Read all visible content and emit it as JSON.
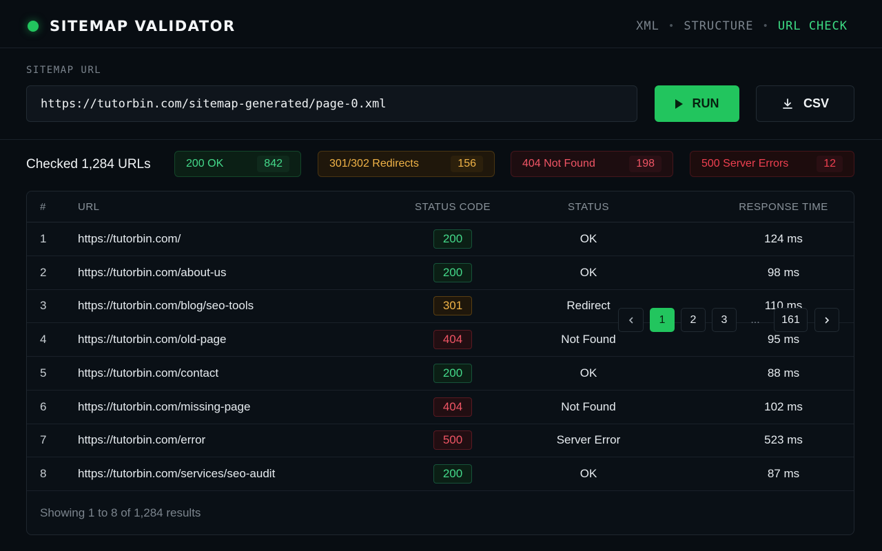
{
  "header": {
    "title": "SITEMAP VALIDATOR",
    "nav": [
      {
        "label": "XML",
        "active": false
      },
      {
        "label": "STRUCTURE",
        "active": false
      },
      {
        "label": "URL CHECK",
        "active": true
      }
    ]
  },
  "url_section": {
    "label": "SITEMAP URL",
    "value": "https://tutorbin.com/sitemap-generated/page-0.xml",
    "run_label": "RUN",
    "csv_label": "CSV"
  },
  "summary": {
    "checked_text": "Checked 1,284 URLs",
    "ok": {
      "label": "200 OK",
      "count": "842"
    },
    "redirects": {
      "label": "301/302 Redirects",
      "count": "156"
    },
    "not_found": {
      "label": "404 Not Found",
      "count": "198"
    },
    "server_errors": {
      "label": "500 Server Errors",
      "count": "12"
    }
  },
  "table": {
    "headers": {
      "num": "#",
      "url": "URL",
      "code": "STATUS CODE",
      "status": "STATUS",
      "time": "RESPONSE TIME"
    },
    "rows": [
      {
        "num": "1",
        "url": "https://tutorbin.com/",
        "code": "200",
        "status": "OK",
        "time": "124 ms"
      },
      {
        "num": "2",
        "url": "https://tutorbin.com/about-us",
        "code": "200",
        "status": "OK",
        "time": "98 ms"
      },
      {
        "num": "3",
        "url": "https://tutorbin.com/blog/seo-tools",
        "code": "301",
        "status": "Redirect",
        "time": "110 ms"
      },
      {
        "num": "4",
        "url": "https://tutorbin.com/old-page",
        "code": "404",
        "status": "Not Found",
        "time": "95 ms"
      },
      {
        "num": "5",
        "url": "https://tutorbin.com/contact",
        "code": "200",
        "status": "OK",
        "time": "88 ms"
      },
      {
        "num": "6",
        "url": "https://tutorbin.com/missing-page",
        "code": "404",
        "status": "Not Found",
        "time": "102 ms"
      },
      {
        "num": "7",
        "url": "https://tutorbin.com/error",
        "code": "500",
        "status": "Server Error",
        "time": "523 ms"
      },
      {
        "num": "8",
        "url": "https://tutorbin.com/services/seo-audit",
        "code": "200",
        "status": "OK",
        "time": "87 ms"
      }
    ],
    "footer_text": "Showing 1 to 8 of 1,284 results"
  },
  "pagination": {
    "prev_icon": "chevron-left-icon",
    "pages": [
      "1",
      "2",
      "3",
      "...",
      "161"
    ],
    "current": "1",
    "next_icon": "chevron-right-icon"
  },
  "colors": {
    "accent": "#22c55e",
    "ok": "#44d98a",
    "redirect": "#f0b347",
    "error": "#f05565",
    "background": "#080d12"
  }
}
